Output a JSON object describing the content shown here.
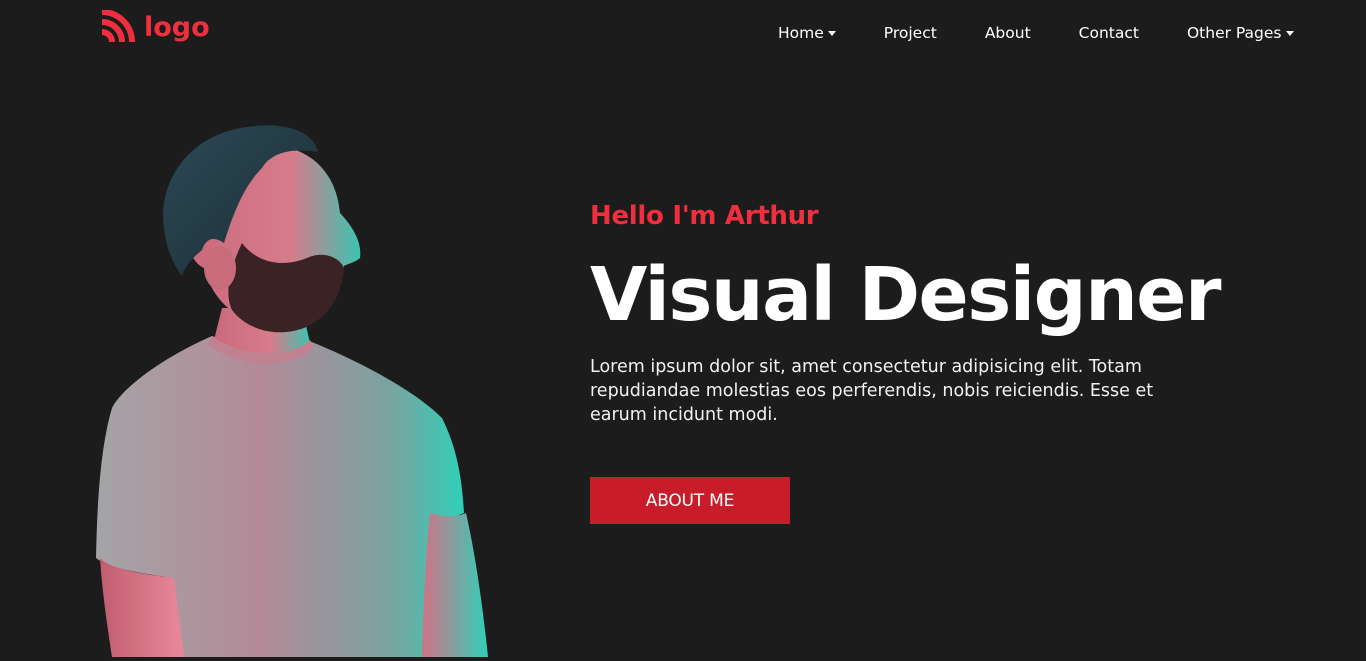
{
  "brand": {
    "logo_text": "logo",
    "accent_color": "#ef2f3e",
    "button_color": "#c91c2a"
  },
  "nav": {
    "items": [
      {
        "label": "Home",
        "has_dropdown": true
      },
      {
        "label": "Project",
        "has_dropdown": false
      },
      {
        "label": "About",
        "has_dropdown": false
      },
      {
        "label": "Contact",
        "has_dropdown": false
      },
      {
        "label": "Other Pages",
        "has_dropdown": true
      }
    ]
  },
  "hero": {
    "greeting": "Hello I'm Arthur",
    "headline": "Visual Designer",
    "description": "Lorem ipsum dolor sit, amet consectetur adipisicing elit. Totam repudiandae molestias eos perferendis, nobis reiciendis. Esse et earum incidunt modi.",
    "cta_label": "ABOUT ME",
    "portrait_icon": "person-portrait"
  }
}
